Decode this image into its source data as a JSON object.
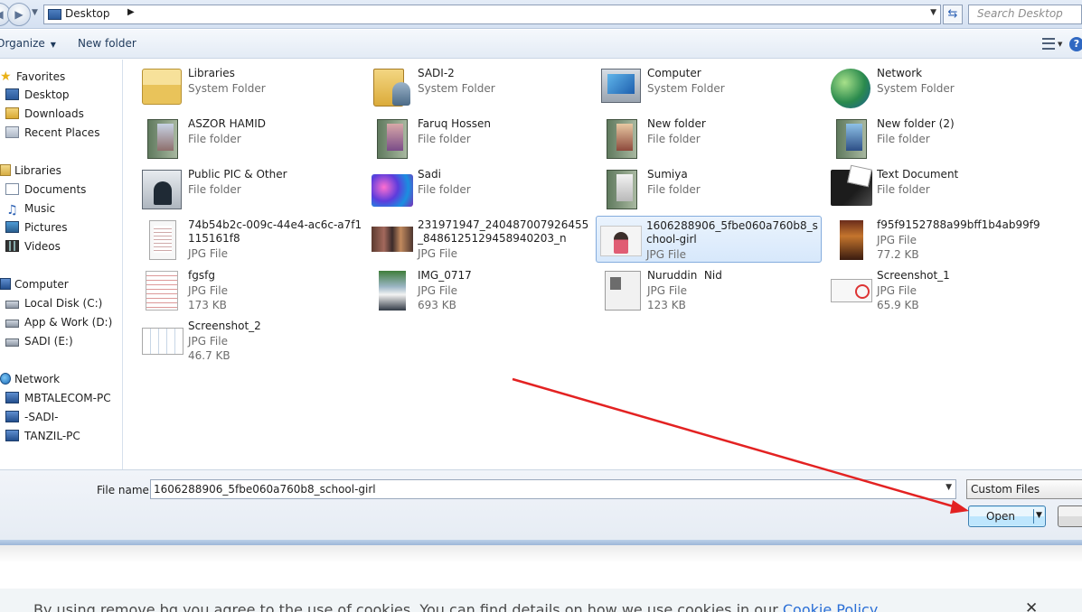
{
  "address": {
    "location": "Desktop",
    "search_placeholder": "Search Desktop"
  },
  "toolbar": {
    "organize": "Organize",
    "new_folder": "New folder"
  },
  "nav": {
    "favorites": "Favorites",
    "favorite_items": [
      "Desktop",
      "Downloads",
      "Recent Places"
    ],
    "libraries": "Libraries",
    "library_items": [
      "Documents",
      "Music",
      "Pictures",
      "Videos"
    ],
    "computer": "Computer",
    "drives": [
      "Local Disk (C:)",
      "App & Work (D:)",
      "SADI (E:)"
    ],
    "network": "Network",
    "network_items": [
      "MBTALECOM-PC",
      "-SADI-",
      "TANZIL-PC"
    ]
  },
  "items": [
    {
      "name": "Libraries",
      "type": "System Folder",
      "size": "",
      "icon": "libraries-icon"
    },
    {
      "name": "SADI-2",
      "type": "System Folder",
      "size": "",
      "icon": "user-folder-icon"
    },
    {
      "name": "Computer",
      "type": "System Folder",
      "size": "",
      "icon": "computer-icon"
    },
    {
      "name": "Network",
      "type": "System Folder",
      "size": "",
      "icon": "network-icon"
    },
    {
      "name": "ASZOR HAMID",
      "type": "File folder",
      "size": "",
      "icon": "folder-icon"
    },
    {
      "name": "Faruq Hossen",
      "type": "File folder",
      "size": "",
      "icon": "folder-icon"
    },
    {
      "name": "New folder",
      "type": "File folder",
      "size": "",
      "icon": "folder-icon"
    },
    {
      "name": "New folder (2)",
      "type": "File folder",
      "size": "",
      "icon": "folder-icon"
    },
    {
      "name": "Public PIC & Other",
      "type": "File folder",
      "size": "",
      "icon": "folder-icon"
    },
    {
      "name": "Sadi",
      "type": "File folder",
      "size": "",
      "icon": "folder-icon"
    },
    {
      "name": "Sumiya",
      "type": "File folder",
      "size": "",
      "icon": "folder-icon"
    },
    {
      "name": "Text Document",
      "type": "File folder",
      "size": "",
      "icon": "folder-icon"
    },
    {
      "name": "74b54b2c-009c-44e4-ac6c-a7f1115161f8",
      "type": "JPG File",
      "size": "",
      "icon": "image-thumbnail"
    },
    {
      "name": "231971947_240487007926455_8486125129458940203_n",
      "type": "JPG File",
      "size": "",
      "icon": "image-thumbnail"
    },
    {
      "name": "1606288906_5fbe060a760b8_school-girl",
      "type": "JPG File",
      "size": "",
      "icon": "image-thumbnail"
    },
    {
      "name": "f95f9152788a99bff1b4ab99f9",
      "type": "JPG File",
      "size": "77.2 KB",
      "icon": "image-thumbnail"
    },
    {
      "name": "fgsfg",
      "type": "JPG File",
      "size": "173 KB",
      "icon": "image-thumbnail"
    },
    {
      "name": "IMG_0717",
      "type": "JPG File",
      "size": "693 KB",
      "icon": "image-thumbnail"
    },
    {
      "name": "Nuruddin  Nid",
      "type": "JPG File",
      "size": "123 KB",
      "icon": "image-thumbnail"
    },
    {
      "name": "Screenshot_1",
      "type": "JPG File",
      "size": "65.9 KB",
      "icon": "image-thumbnail"
    },
    {
      "name": "Screenshot_2",
      "type": "JPG File",
      "size": "46.7 KB",
      "icon": "image-thumbnail"
    }
  ],
  "bottom": {
    "file_name_label": "File name:",
    "file_name_value": "1606288906_5fbe060a760b8_school-girl",
    "filter": "Custom Files",
    "open": "Open"
  },
  "cookie": {
    "message": "By using remove.bg you agree to the use of cookies. You can find details on how we use cookies in our ",
    "link": "Cookie Policy",
    "close": "✕"
  },
  "colors": {
    "annotation_arrow": "#e32222",
    "selection": "#d7e8fb",
    "link": "#2b6fd6"
  }
}
